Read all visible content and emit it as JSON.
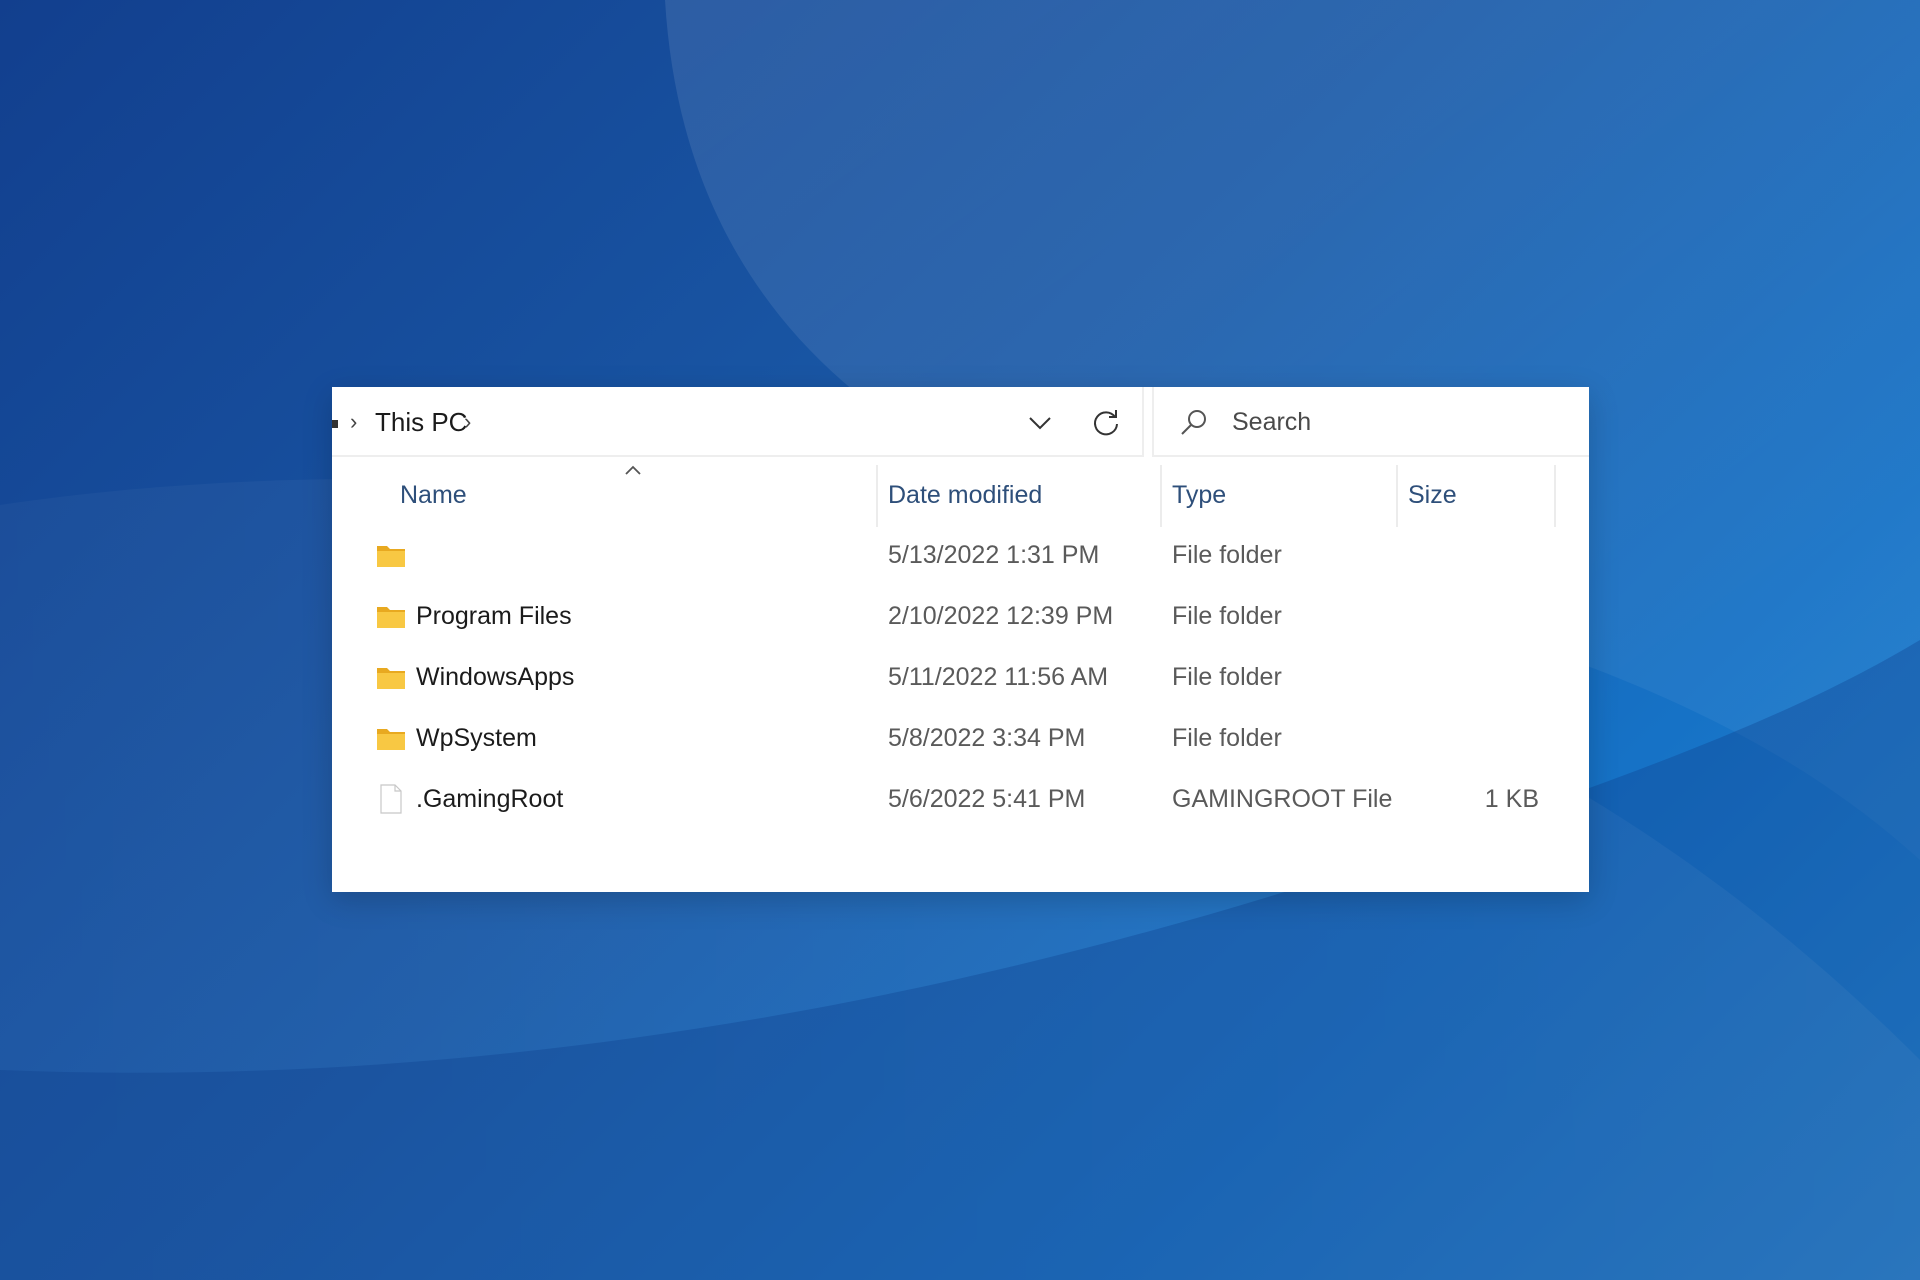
{
  "colors": {
    "background_dark": "#123f8e",
    "background_light": "#2a8bd4",
    "window_bg": "#ffffff",
    "header_text": "#2e4f7a",
    "folder_yellow": "#f8c843"
  },
  "address_bar": {
    "crumbs": [
      "This PC"
    ],
    "dropdown_icon": "chevron-down-icon",
    "refresh_icon": "refresh-icon"
  },
  "search": {
    "placeholder": "Search",
    "icon": "search-icon"
  },
  "columns": {
    "name": "Name",
    "date_modified": "Date modified",
    "type": "Type",
    "size": "Size",
    "sorted_by": "Name",
    "sort_direction": "ascending"
  },
  "rows": [
    {
      "icon": "folder-icon",
      "name": "",
      "date": "5/13/2022 1:31 PM",
      "type": "File folder",
      "size": ""
    },
    {
      "icon": "folder-icon",
      "name": "Program Files",
      "date": "2/10/2022 12:39 PM",
      "type": "File folder",
      "size": ""
    },
    {
      "icon": "folder-icon",
      "name": "WindowsApps",
      "date": "5/11/2022 11:56 AM",
      "type": "File folder",
      "size": ""
    },
    {
      "icon": "folder-icon",
      "name": "WpSystem",
      "date": "5/8/2022 3:34 PM",
      "type": "File folder",
      "size": ""
    },
    {
      "icon": "file-icon",
      "name": ".GamingRoot",
      "date": "5/6/2022 5:41 PM",
      "type": "GAMINGROOT File",
      "size": "1 KB"
    }
  ]
}
